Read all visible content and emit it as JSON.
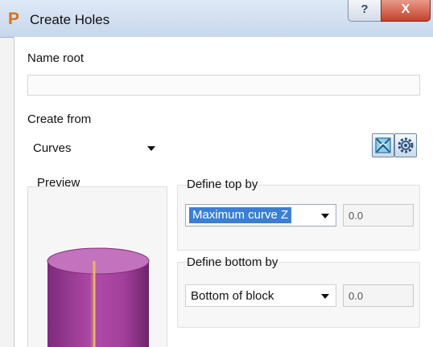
{
  "window": {
    "title": "Create Holes",
    "app_icon": "P",
    "help_glyph": "?",
    "close_glyph": "X"
  },
  "form": {
    "name_root_label": "Name root",
    "name_root_value": "",
    "create_from_label": "Create from",
    "create_from_value": "Curves",
    "preview_label": "Preview",
    "define_top_label": "Define top by",
    "define_top_value": "Maximum curve Z",
    "define_top_number": "0.0",
    "define_bottom_label": "Define bottom by",
    "define_bottom_value": "Bottom of block",
    "define_bottom_number": "0.0"
  },
  "icons": {
    "tool1": "select-curves-icon",
    "tool2": "settings-gear-icon"
  },
  "colors": {
    "accent": "#3b7fd4",
    "app_icon": "#d5731c",
    "close_button": "#c6402b",
    "cylinder": "#9c3d96"
  }
}
